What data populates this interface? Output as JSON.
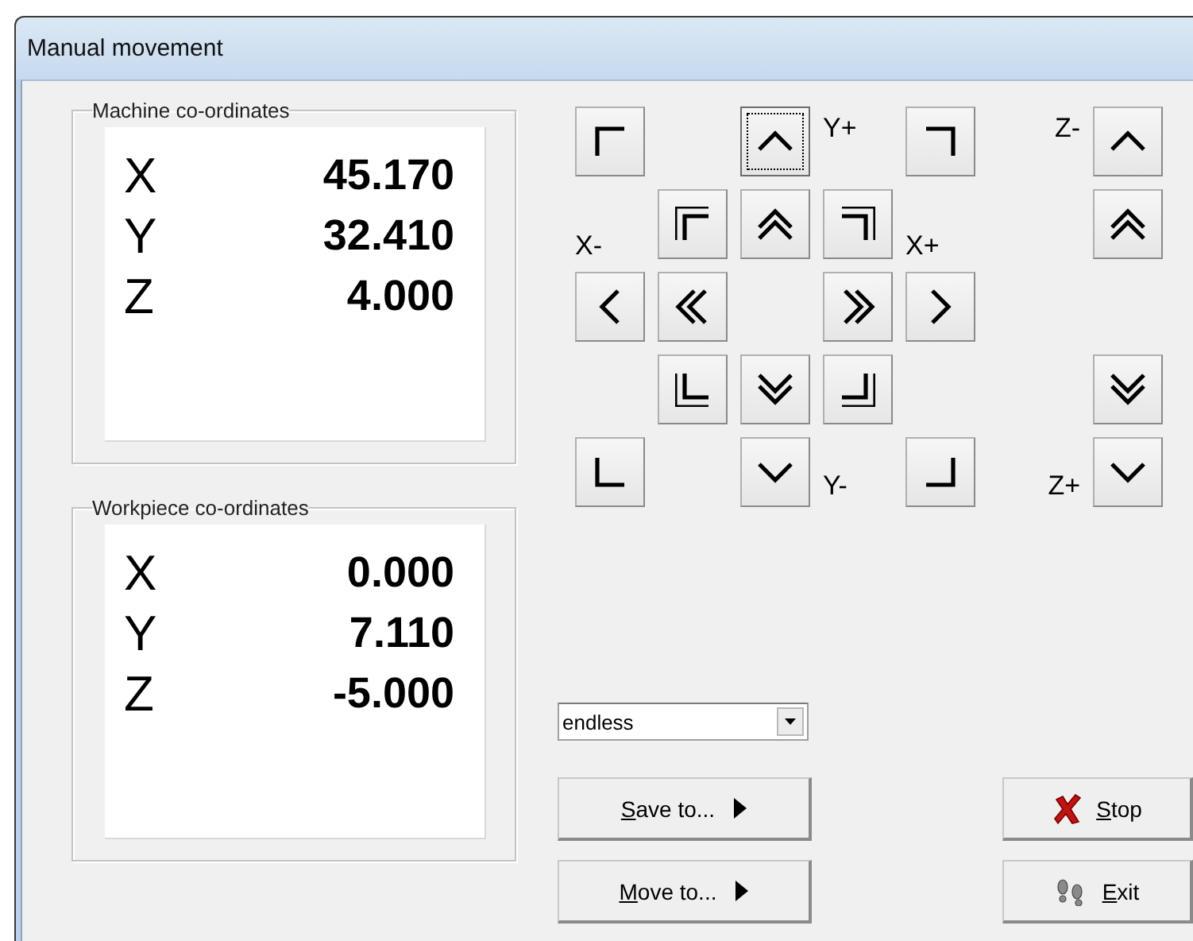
{
  "window": {
    "title": "Manual movement"
  },
  "coordinate_groups": [
    {
      "title": "Machine co-ordinates",
      "axes": [
        {
          "axis": "X",
          "value": "45.170"
        },
        {
          "axis": "Y",
          "value": "32.410"
        },
        {
          "axis": "Z",
          "value": "4.000"
        }
      ]
    },
    {
      "title": "Workpiece co-ordinates",
      "axes": [
        {
          "axis": "X",
          "value": "0.000"
        },
        {
          "axis": "Y",
          "value": "7.110"
        },
        {
          "axis": "Z",
          "value": "-5.000"
        }
      ]
    }
  ],
  "jog_grid": {
    "rows": [
      [
        {
          "kind": "corner-tl",
          "focused": false
        },
        null,
        {
          "kind": "up",
          "focused": true
        },
        {
          "kind": "label",
          "text": "Y+"
        },
        {
          "kind": "corner-tr",
          "focused": false
        },
        {
          "kind": "label",
          "text": "Z-"
        },
        {
          "kind": "up",
          "focused": false
        }
      ],
      [
        {
          "kind": "label",
          "text": "X-"
        },
        {
          "kind": "double-corner-tl",
          "focused": false
        },
        {
          "kind": "double-up",
          "focused": false
        },
        {
          "kind": "double-corner-tr",
          "focused": false
        },
        {
          "kind": "label",
          "text": "X+"
        },
        null,
        {
          "kind": "double-up",
          "focused": false
        }
      ],
      [
        {
          "kind": "left",
          "focused": false
        },
        {
          "kind": "double-left",
          "focused": false
        },
        null,
        {
          "kind": "double-right",
          "focused": false
        },
        {
          "kind": "right",
          "focused": false
        },
        null,
        null
      ],
      [
        null,
        {
          "kind": "double-corner-bl",
          "focused": false
        },
        {
          "kind": "double-down",
          "focused": false
        },
        {
          "kind": "double-corner-br",
          "focused": false
        },
        null,
        null,
        {
          "kind": "double-down",
          "focused": false
        }
      ],
      [
        {
          "kind": "corner-bl",
          "focused": false
        },
        null,
        {
          "kind": "down",
          "focused": false
        },
        {
          "kind": "label",
          "text": "Y-"
        },
        {
          "kind": "corner-br",
          "focused": false
        },
        {
          "kind": "label",
          "text": "Z+"
        },
        {
          "kind": "down",
          "focused": false
        }
      ]
    ]
  },
  "step_dropdown": {
    "value": "endless"
  },
  "buttons": [
    {
      "label": "Save to...",
      "first_letter_underlined": true,
      "kind": "submenu"
    },
    {
      "label": "Stop",
      "first_letter_underlined": true,
      "kind": "stop"
    },
    {
      "label": "Move to...",
      "first_letter_underlined": true,
      "kind": "submenu"
    },
    {
      "label": "Exit",
      "first_letter_underlined": true,
      "kind": "exit"
    }
  ]
}
